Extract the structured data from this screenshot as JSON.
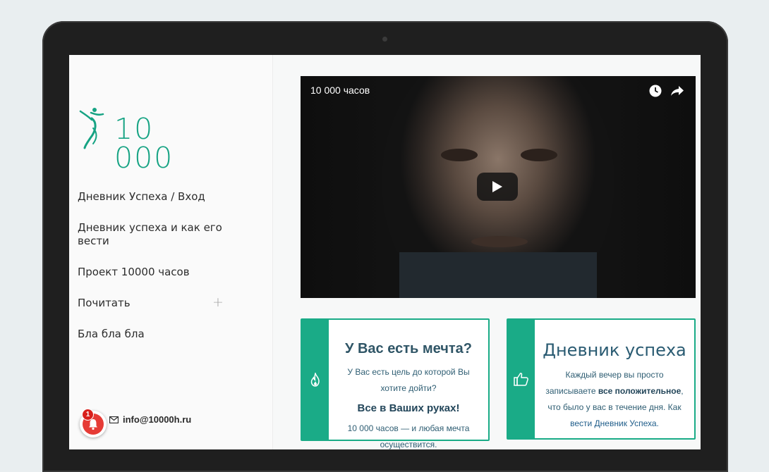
{
  "logo": {
    "text": "10 000"
  },
  "nav": {
    "items": [
      {
        "label": "Дневник Успеха / Вход"
      },
      {
        "label": "Дневник успеха и как его вести"
      },
      {
        "label": "Проект 10000 часов"
      },
      {
        "label": "Почитать",
        "expand": "+"
      },
      {
        "label": "Бла бла бла"
      }
    ]
  },
  "contact": {
    "email": "info@10000h.ru"
  },
  "notifications": {
    "count": "1"
  },
  "video": {
    "title": "10 000 часов"
  },
  "card1": {
    "title": "У Вас есть мечта?",
    "line1": "У Вас есть цель до которой Вы",
    "line2": "хотите дойти?",
    "subtitle": "Все в Ваших руках!",
    "line3": "10 000 часов — и любая мечта",
    "line4": "осуществится."
  },
  "card2": {
    "title": "Дневник успеха",
    "line1": "Каждый вечер вы просто",
    "line2a": "записываете ",
    "line2b": "все положительное",
    "line2c": ",",
    "line3": "что было у вас в течение дня. Как",
    "line4": "вести Дневник Успеха."
  },
  "colors": {
    "accent": "#1aab87",
    "heading": "#2f5566"
  }
}
